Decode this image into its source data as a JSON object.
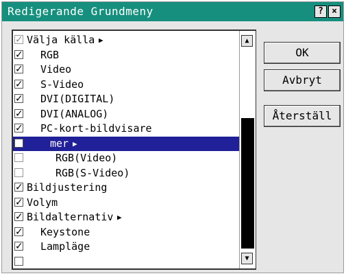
{
  "window": {
    "title": "Redigerande Grundmeny",
    "help_label": "?",
    "close_label": "×"
  },
  "list": [
    {
      "label": "Välja källa",
      "checked": true,
      "disabled": true,
      "indent": 0,
      "arrow": "▶",
      "selected": false
    },
    {
      "label": "RGB",
      "checked": true,
      "disabled": false,
      "indent": 1,
      "arrow": "",
      "selected": false
    },
    {
      "label": "Video",
      "checked": true,
      "disabled": false,
      "indent": 1,
      "arrow": "",
      "selected": false
    },
    {
      "label": "S-Video",
      "checked": true,
      "disabled": false,
      "indent": 1,
      "arrow": "",
      "selected": false
    },
    {
      "label": "DVI(DIGITAL)",
      "checked": true,
      "disabled": false,
      "indent": 1,
      "arrow": "",
      "selected": false
    },
    {
      "label": "DVI(ANALOG)",
      "checked": true,
      "disabled": false,
      "indent": 1,
      "arrow": "",
      "selected": false
    },
    {
      "label": "PC-kort-bildvisare",
      "checked": true,
      "disabled": false,
      "indent": 1,
      "arrow": "",
      "selected": false
    },
    {
      "label": "mer",
      "checked": false,
      "disabled": false,
      "indent": 2,
      "arrow": "▶",
      "selected": true
    },
    {
      "label": "RGB(Video)",
      "checked": false,
      "disabled": true,
      "indent": 3,
      "arrow": "",
      "selected": false
    },
    {
      "label": "RGB(S-Video)",
      "checked": false,
      "disabled": true,
      "indent": 3,
      "arrow": "",
      "selected": false
    },
    {
      "label": "Bildjustering",
      "checked": true,
      "disabled": false,
      "indent": 0,
      "arrow": "",
      "selected": false
    },
    {
      "label": "Volym",
      "checked": true,
      "disabled": false,
      "indent": 0,
      "arrow": "",
      "selected": false
    },
    {
      "label": "Bildalternativ",
      "checked": true,
      "disabled": false,
      "indent": 0,
      "arrow": "▶",
      "selected": false
    },
    {
      "label": "Keystone",
      "checked": true,
      "disabled": false,
      "indent": 1,
      "arrow": "",
      "selected": false
    },
    {
      "label": "Lampläge",
      "checked": true,
      "disabled": false,
      "indent": 1,
      "arrow": "",
      "selected": false
    },
    {
      "label": "",
      "checked": false,
      "disabled": false,
      "indent": 1,
      "arrow": "",
      "selected": false
    }
  ],
  "scrollbar": {
    "up_label": "▲",
    "down_label": "▼"
  },
  "buttons": {
    "ok": "OK",
    "cancel": "Avbryt",
    "reset": "Återställ"
  },
  "colors": {
    "titlebar": "#178f7e",
    "selection": "#202098"
  }
}
